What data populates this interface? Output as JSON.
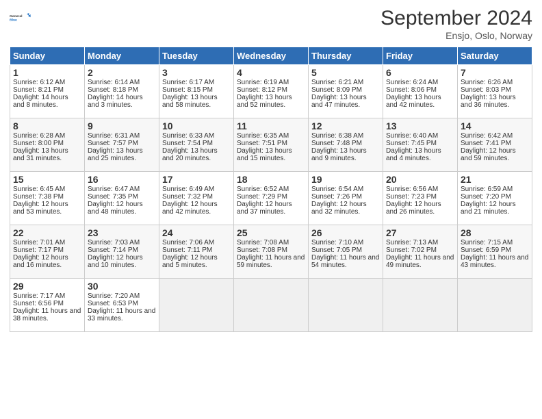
{
  "header": {
    "logo_line1": "General",
    "logo_line2": "Blue",
    "month_title": "September 2024",
    "location": "Ensjo, Oslo, Norway"
  },
  "columns": [
    "Sunday",
    "Monday",
    "Tuesday",
    "Wednesday",
    "Thursday",
    "Friday",
    "Saturday"
  ],
  "weeks": [
    [
      {
        "day": "1",
        "sunrise": "Sunrise: 6:12 AM",
        "sunset": "Sunset: 8:21 PM",
        "daylight": "Daylight: 14 hours and 8 minutes."
      },
      {
        "day": "2",
        "sunrise": "Sunrise: 6:14 AM",
        "sunset": "Sunset: 8:18 PM",
        "daylight": "Daylight: 14 hours and 3 minutes."
      },
      {
        "day": "3",
        "sunrise": "Sunrise: 6:17 AM",
        "sunset": "Sunset: 8:15 PM",
        "daylight": "Daylight: 13 hours and 58 minutes."
      },
      {
        "day": "4",
        "sunrise": "Sunrise: 6:19 AM",
        "sunset": "Sunset: 8:12 PM",
        "daylight": "Daylight: 13 hours and 52 minutes."
      },
      {
        "day": "5",
        "sunrise": "Sunrise: 6:21 AM",
        "sunset": "Sunset: 8:09 PM",
        "daylight": "Daylight: 13 hours and 47 minutes."
      },
      {
        "day": "6",
        "sunrise": "Sunrise: 6:24 AM",
        "sunset": "Sunset: 8:06 PM",
        "daylight": "Daylight: 13 hours and 42 minutes."
      },
      {
        "day": "7",
        "sunrise": "Sunrise: 6:26 AM",
        "sunset": "Sunset: 8:03 PM",
        "daylight": "Daylight: 13 hours and 36 minutes."
      }
    ],
    [
      {
        "day": "8",
        "sunrise": "Sunrise: 6:28 AM",
        "sunset": "Sunset: 8:00 PM",
        "daylight": "Daylight: 13 hours and 31 minutes."
      },
      {
        "day": "9",
        "sunrise": "Sunrise: 6:31 AM",
        "sunset": "Sunset: 7:57 PM",
        "daylight": "Daylight: 13 hours and 25 minutes."
      },
      {
        "day": "10",
        "sunrise": "Sunrise: 6:33 AM",
        "sunset": "Sunset: 7:54 PM",
        "daylight": "Daylight: 13 hours and 20 minutes."
      },
      {
        "day": "11",
        "sunrise": "Sunrise: 6:35 AM",
        "sunset": "Sunset: 7:51 PM",
        "daylight": "Daylight: 13 hours and 15 minutes."
      },
      {
        "day": "12",
        "sunrise": "Sunrise: 6:38 AM",
        "sunset": "Sunset: 7:48 PM",
        "daylight": "Daylight: 13 hours and 9 minutes."
      },
      {
        "day": "13",
        "sunrise": "Sunrise: 6:40 AM",
        "sunset": "Sunset: 7:45 PM",
        "daylight": "Daylight: 13 hours and 4 minutes."
      },
      {
        "day": "14",
        "sunrise": "Sunrise: 6:42 AM",
        "sunset": "Sunset: 7:41 PM",
        "daylight": "Daylight: 12 hours and 59 minutes."
      }
    ],
    [
      {
        "day": "15",
        "sunrise": "Sunrise: 6:45 AM",
        "sunset": "Sunset: 7:38 PM",
        "daylight": "Daylight: 12 hours and 53 minutes."
      },
      {
        "day": "16",
        "sunrise": "Sunrise: 6:47 AM",
        "sunset": "Sunset: 7:35 PM",
        "daylight": "Daylight: 12 hours and 48 minutes."
      },
      {
        "day": "17",
        "sunrise": "Sunrise: 6:49 AM",
        "sunset": "Sunset: 7:32 PM",
        "daylight": "Daylight: 12 hours and 42 minutes."
      },
      {
        "day": "18",
        "sunrise": "Sunrise: 6:52 AM",
        "sunset": "Sunset: 7:29 PM",
        "daylight": "Daylight: 12 hours and 37 minutes."
      },
      {
        "day": "19",
        "sunrise": "Sunrise: 6:54 AM",
        "sunset": "Sunset: 7:26 PM",
        "daylight": "Daylight: 12 hours and 32 minutes."
      },
      {
        "day": "20",
        "sunrise": "Sunrise: 6:56 AM",
        "sunset": "Sunset: 7:23 PM",
        "daylight": "Daylight: 12 hours and 26 minutes."
      },
      {
        "day": "21",
        "sunrise": "Sunrise: 6:59 AM",
        "sunset": "Sunset: 7:20 PM",
        "daylight": "Daylight: 12 hours and 21 minutes."
      }
    ],
    [
      {
        "day": "22",
        "sunrise": "Sunrise: 7:01 AM",
        "sunset": "Sunset: 7:17 PM",
        "daylight": "Daylight: 12 hours and 16 minutes."
      },
      {
        "day": "23",
        "sunrise": "Sunrise: 7:03 AM",
        "sunset": "Sunset: 7:14 PM",
        "daylight": "Daylight: 12 hours and 10 minutes."
      },
      {
        "day": "24",
        "sunrise": "Sunrise: 7:06 AM",
        "sunset": "Sunset: 7:11 PM",
        "daylight": "Daylight: 12 hours and 5 minutes."
      },
      {
        "day": "25",
        "sunrise": "Sunrise: 7:08 AM",
        "sunset": "Sunset: 7:08 PM",
        "daylight": "Daylight: 11 hours and 59 minutes."
      },
      {
        "day": "26",
        "sunrise": "Sunrise: 7:10 AM",
        "sunset": "Sunset: 7:05 PM",
        "daylight": "Daylight: 11 hours and 54 minutes."
      },
      {
        "day": "27",
        "sunrise": "Sunrise: 7:13 AM",
        "sunset": "Sunset: 7:02 PM",
        "daylight": "Daylight: 11 hours and 49 minutes."
      },
      {
        "day": "28",
        "sunrise": "Sunrise: 7:15 AM",
        "sunset": "Sunset: 6:59 PM",
        "daylight": "Daylight: 11 hours and 43 minutes."
      }
    ],
    [
      {
        "day": "29",
        "sunrise": "Sunrise: 7:17 AM",
        "sunset": "Sunset: 6:56 PM",
        "daylight": "Daylight: 11 hours and 38 minutes."
      },
      {
        "day": "30",
        "sunrise": "Sunrise: 7:20 AM",
        "sunset": "Sunset: 6:53 PM",
        "daylight": "Daylight: 11 hours and 33 minutes."
      },
      null,
      null,
      null,
      null,
      null
    ]
  ]
}
